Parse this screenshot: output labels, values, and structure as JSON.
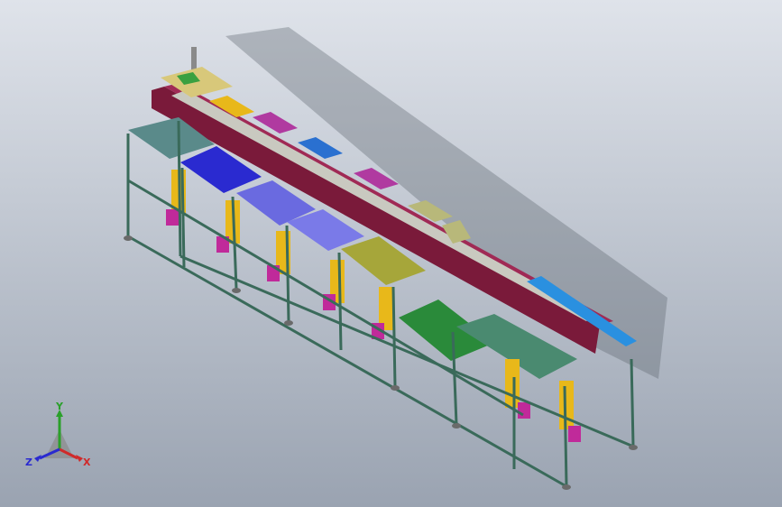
{
  "viewport": {
    "background_top": "#dfe3ea",
    "background_bottom": "#9aa3b1"
  },
  "model": {
    "description_free": true,
    "station_colors": [
      "#6a8e8e",
      "#2a2ad0",
      "#6a6ae0",
      "#7a7ae8",
      "#a6a63a",
      "#2a8a3a",
      "#5a8a6a"
    ],
    "beam_color": "#7a1a3a",
    "frame_color": "#3a6a5a",
    "panel_color": "#e8b81a",
    "fixture_color": "#c02a9a"
  },
  "triad": {
    "y_label": "Y",
    "x_label": "X",
    "z_label": "Z",
    "y_color": "#2aa02a",
    "x_color": "#d02a2a",
    "z_color": "#2a2ad0"
  }
}
